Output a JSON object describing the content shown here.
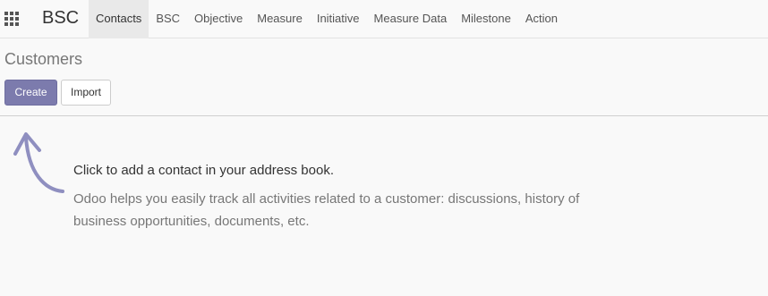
{
  "app": {
    "name": "BSC"
  },
  "menu": {
    "items": [
      {
        "label": "Contacts",
        "active": true
      },
      {
        "label": "BSC"
      },
      {
        "label": "Objective"
      },
      {
        "label": "Measure"
      },
      {
        "label": "Initiative"
      },
      {
        "label": "Measure Data"
      },
      {
        "label": "Milestone"
      },
      {
        "label": "Action"
      }
    ]
  },
  "breadcrumb": "Customers",
  "buttons": {
    "create": "Create",
    "import": "Import"
  },
  "helper": {
    "title": "Click to add a contact in your address book.",
    "text": "Odoo helps you easily track all activities related to a customer: discussions, history of business opportunities, documents, etc."
  },
  "colors": {
    "primary": "#7c7bad",
    "arrow": "#8f8fc0"
  },
  "icons": {
    "apps": "apps-grid-icon",
    "arrow": "curved-arrow-icon"
  }
}
